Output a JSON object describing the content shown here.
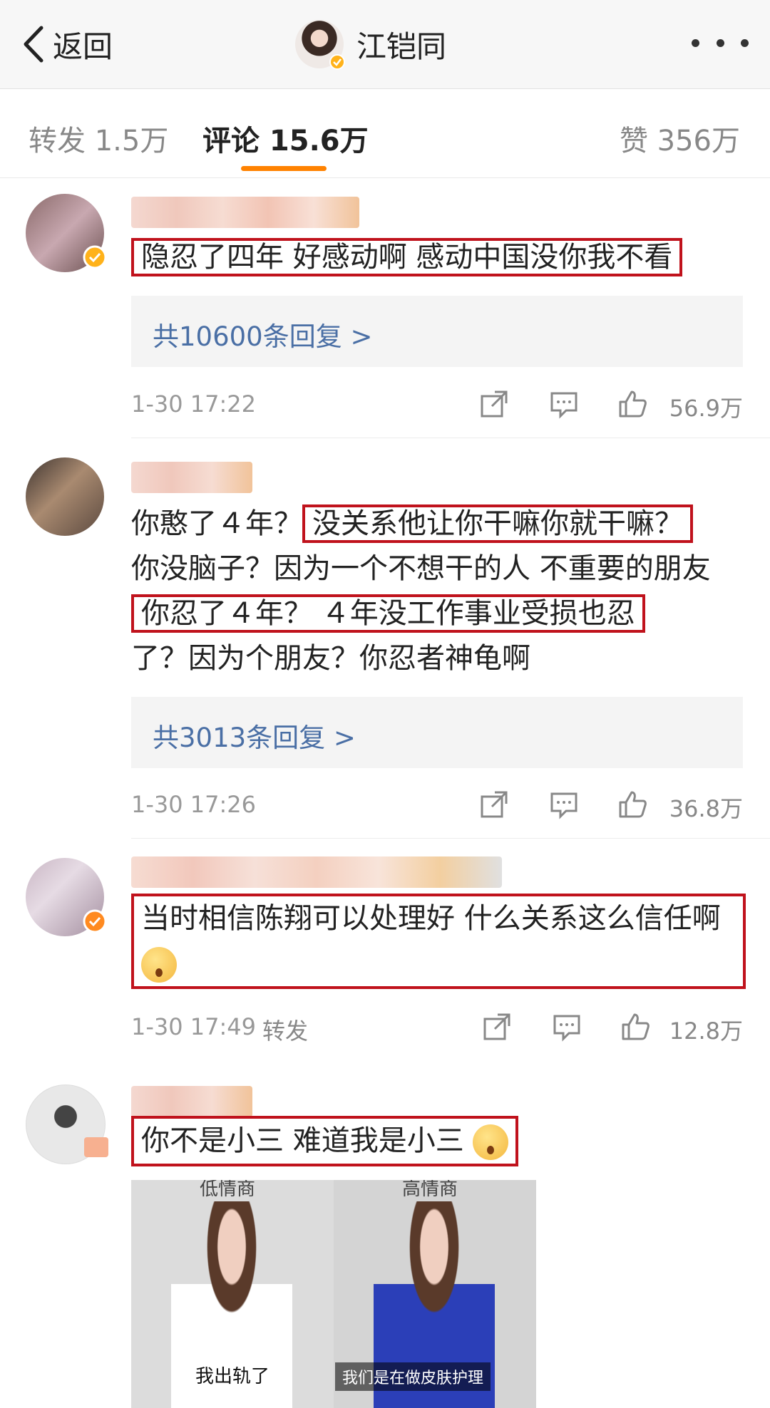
{
  "topbar": {
    "back_label": "返回",
    "title": "江铠同"
  },
  "tabs": {
    "repost": "转发 1.5万",
    "comment": "评论 15.6万",
    "like": "赞 356万"
  },
  "comments": [
    {
      "text": "隐忍了四年 好感动啊 感动中国没你我不看",
      "replies": "共10600条回复 >",
      "time": "1-30 17:22",
      "likes": "56.9万"
    },
    {
      "text_parts": [
        "你憨了４年？",
        "没关系他让你干嘛你就干嘛？",
        "你没脑子？因为一个不想干的人  不重要的朋友",
        "你忍了４年？ ４年没工作事业受损也忍",
        "了？因为个朋友？你忍者神龟啊"
      ],
      "replies": "共3013条回复 >",
      "time": "1-30 17:26",
      "likes": "36.8万"
    },
    {
      "text": "当时相信陈翔可以处理好 什么关系这么信任啊",
      "time": "1-30 17:49",
      "repost_label": "转发",
      "likes": "12.8万"
    },
    {
      "text": "你不是小三 难道我是小三",
      "meme": {
        "left_top": "低情商",
        "right_top": "高情商",
        "left_caption": "我出轨了",
        "right_caption": "我们是在做皮肤护理"
      }
    }
  ],
  "colors": {
    "accent": "#ff8200",
    "link": "#4a6fa5",
    "highlight_box": "#c0121c"
  },
  "icons": [
    "chevron-left-icon",
    "more-icon",
    "share-icon",
    "comment-icon",
    "like-icon",
    "verified-badge-icon"
  ]
}
